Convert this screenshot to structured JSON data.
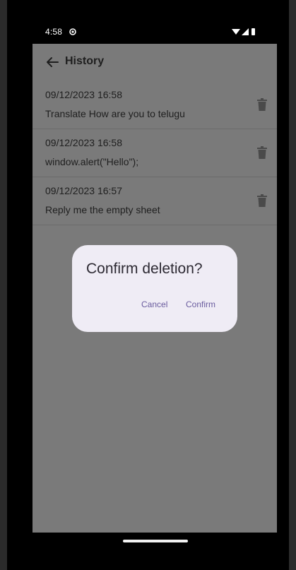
{
  "status_bar": {
    "time": "4:58"
  },
  "app_bar": {
    "title": "History"
  },
  "history": [
    {
      "date": "09/12/2023 16:58",
      "text": "Translate How are you to telugu"
    },
    {
      "date": "09/12/2023 16:58",
      "text": "window.alert(\"Hello\");"
    },
    {
      "date": "09/12/2023 16:57",
      "text": "Reply me the empty sheet"
    }
  ],
  "dialog": {
    "title": "Confirm deletion?",
    "cancel_label": "Cancel",
    "confirm_label": "Confirm"
  },
  "colors": {
    "accent": "#6a5c9e",
    "dialog_bg": "#efecf5",
    "scrim": "#7a7a7a"
  }
}
